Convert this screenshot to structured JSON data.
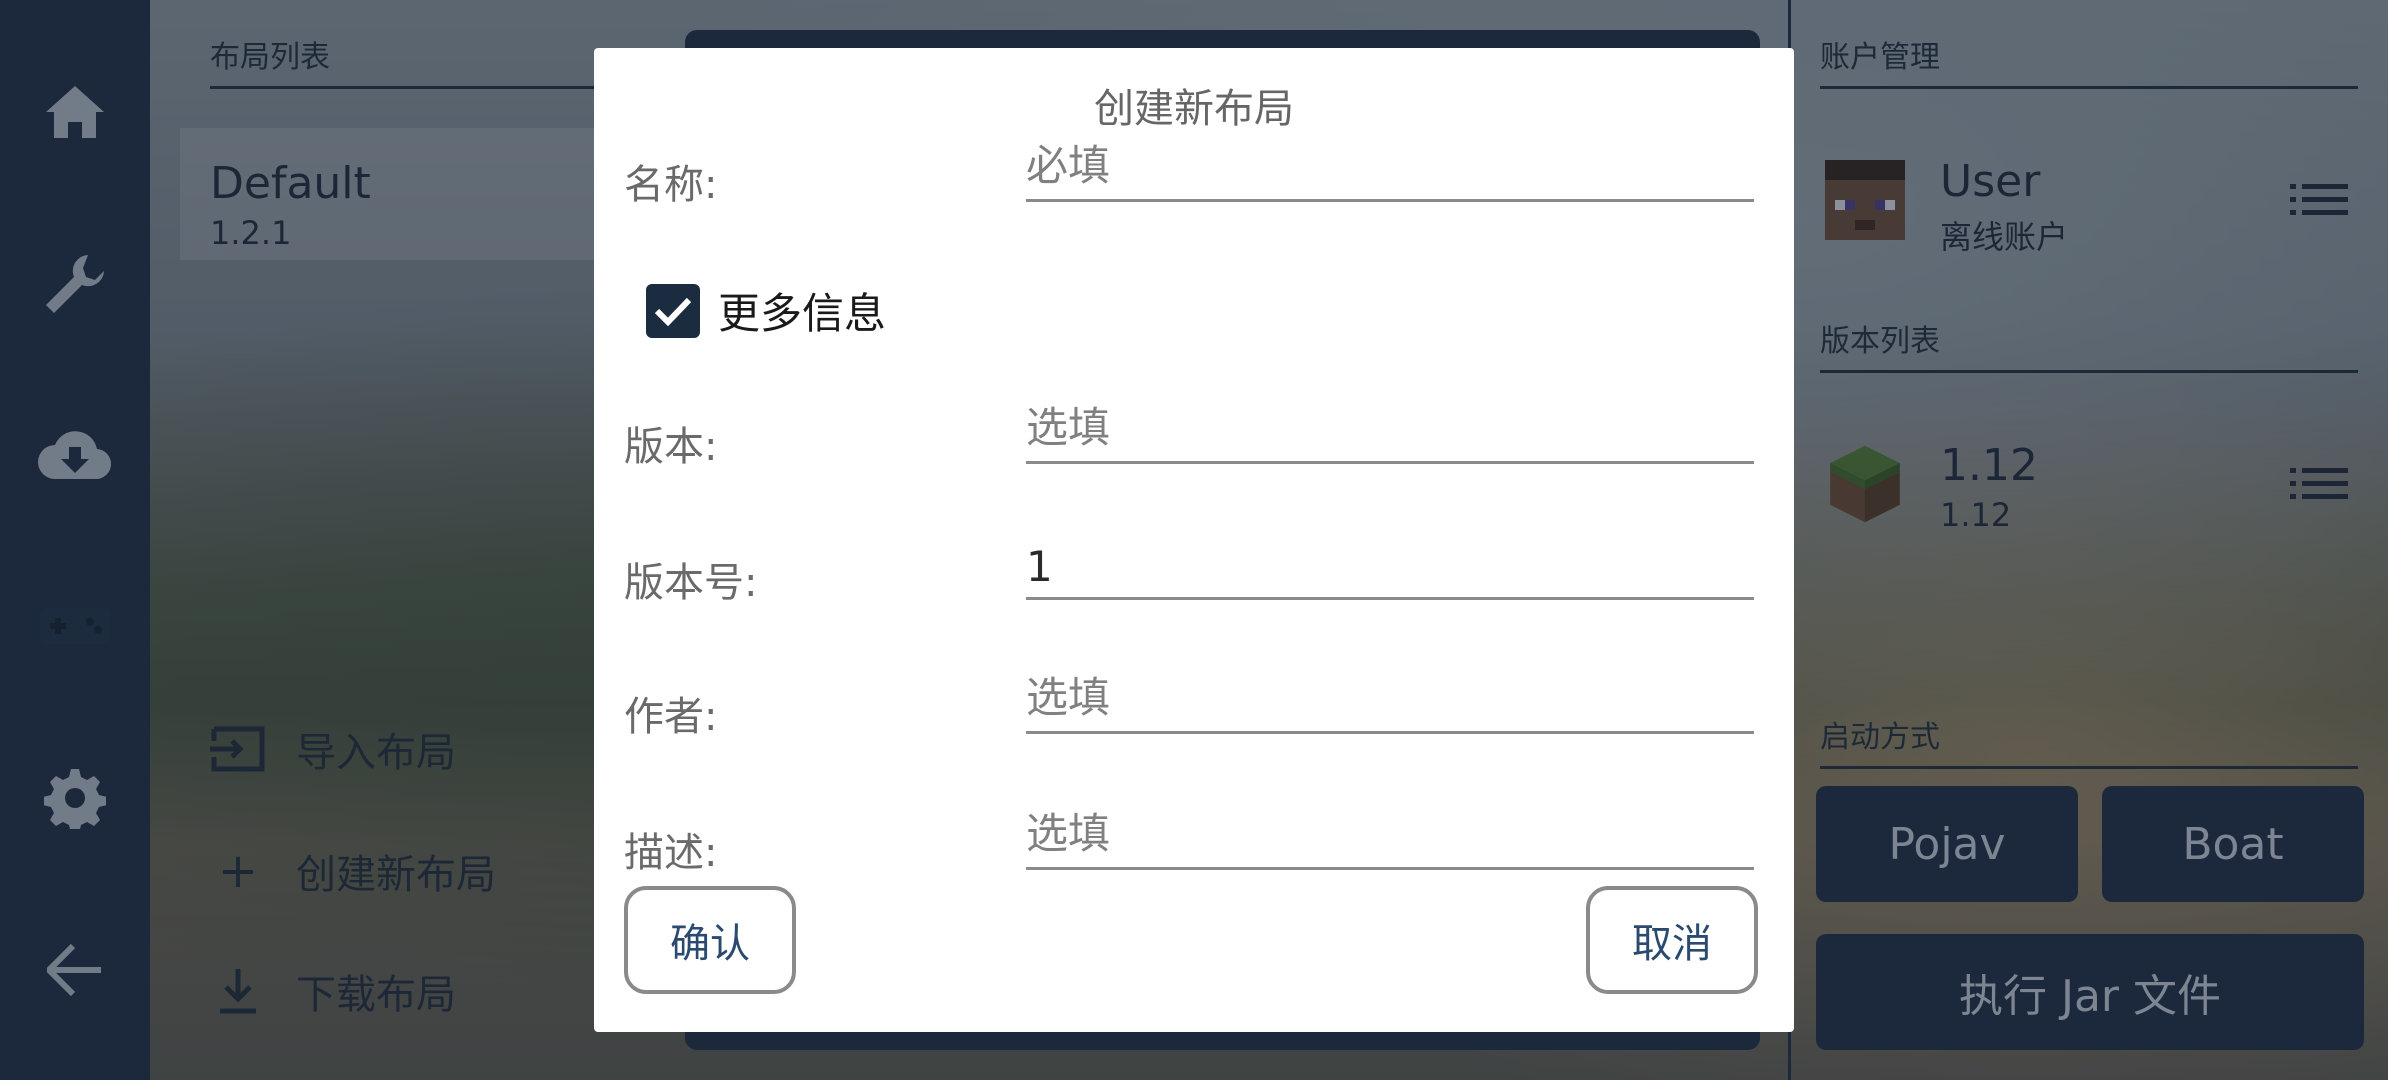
{
  "sidebar": {
    "items": [
      "home-icon",
      "wrench-icon",
      "cloud-download-icon",
      "gamepad-icon",
      "gear-icon",
      "back-arrow-icon"
    ]
  },
  "layouts": {
    "title": "布局列表",
    "item": {
      "name": "Default",
      "version": "1.2.1"
    },
    "actions": {
      "import": "导入布局",
      "create": "创建新布局",
      "download": "下载布局"
    }
  },
  "account": {
    "title": "账户管理",
    "user": {
      "name": "User",
      "type": "离线账户"
    }
  },
  "versions": {
    "title": "版本列表",
    "item": {
      "name": "1.12",
      "sub": "1.12"
    }
  },
  "launch": {
    "title": "启动方式",
    "pojav": "Pojav",
    "boat": "Boat",
    "jar": "执行 Jar 文件"
  },
  "dialog": {
    "title": "创建新布局",
    "name_label": "名称:",
    "name_placeholder": "必填",
    "more_info": "更多信息",
    "more_info_checked": true,
    "version_label": "版本:",
    "version_placeholder": "选填",
    "version_code_label": "版本号:",
    "version_code_value": "1",
    "author_label": "作者:",
    "author_placeholder": "选填",
    "desc_label": "描述:",
    "desc_placeholder": "选填",
    "confirm": "确认",
    "cancel": "取消"
  },
  "colors": {
    "nav": "#1b2b40",
    "accent_text": "#2a4a6f",
    "dialog_bg": "#ffffff"
  }
}
